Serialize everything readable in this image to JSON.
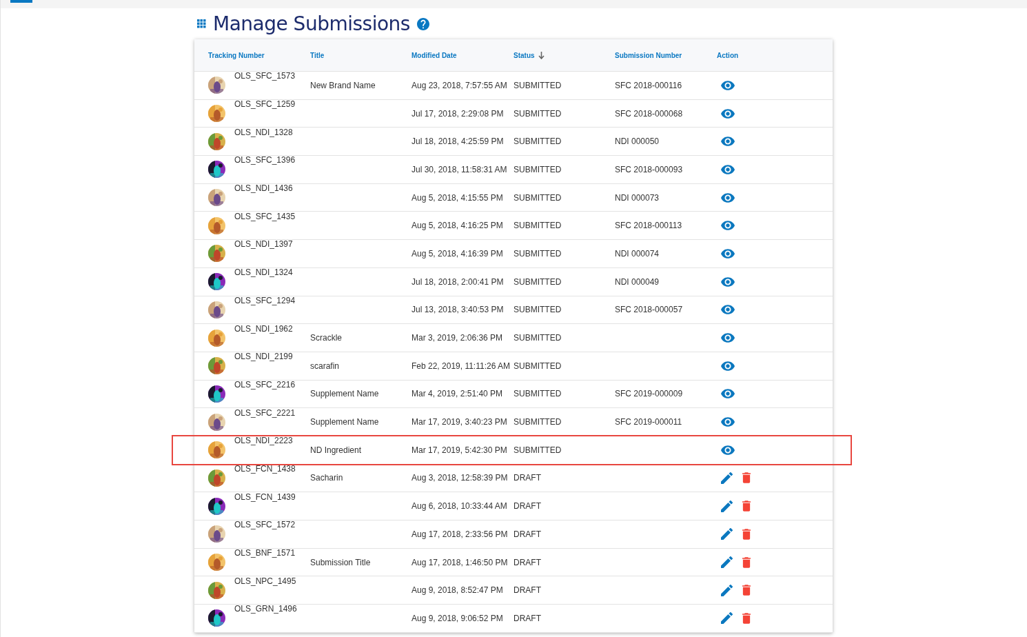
{
  "page": {
    "title": "Manage Submissions"
  },
  "table": {
    "columns": [
      {
        "label": "Tracking Number",
        "sorted": false
      },
      {
        "label": "Title",
        "sorted": false
      },
      {
        "label": "Modified Date",
        "sorted": false
      },
      {
        "label": "Status",
        "sorted": true
      },
      {
        "label": "Submission Number",
        "sorted": false
      },
      {
        "label": "Action",
        "sorted": false
      }
    ],
    "rows": [
      {
        "tracking": "OLS_SFC_1573",
        "title": "New Brand Name",
        "modified": "Aug 23, 2018, 7:57:55 AM",
        "status": "SUBMITTED",
        "submission": "SFC 2018-000116",
        "kind": "viewable",
        "highlighted": false
      },
      {
        "tracking": "OLS_SFC_1259",
        "modified": "Jul 17, 2018, 2:29:08 PM",
        "status": "SUBMITTED",
        "submission": "SFC 2018-000068",
        "kind": "viewable",
        "highlighted": false
      },
      {
        "tracking": "OLS_NDI_1328",
        "modified": "Jul 18, 2018, 4:25:59 PM",
        "status": "SUBMITTED",
        "submission": "NDI 000050",
        "kind": "viewable",
        "highlighted": false
      },
      {
        "tracking": "OLS_SFC_1396",
        "modified": "Jul 30, 2018, 11:58:31 AM",
        "status": "SUBMITTED",
        "submission": "SFC 2018-000093",
        "kind": "viewable",
        "highlighted": false
      },
      {
        "tracking": "OLS_NDI_1436",
        "modified": "Aug 5, 2018, 4:15:55 PM",
        "status": "SUBMITTED",
        "submission": "NDI 000073",
        "kind": "viewable",
        "highlighted": false
      },
      {
        "tracking": "OLS_SFC_1435",
        "modified": "Aug 5, 2018, 4:16:25 PM",
        "status": "SUBMITTED",
        "submission": "SFC 2018-000113",
        "kind": "viewable",
        "highlighted": false
      },
      {
        "tracking": "OLS_NDI_1397",
        "modified": "Aug 5, 2018, 4:16:39 PM",
        "status": "SUBMITTED",
        "submission": "NDI 000074",
        "kind": "viewable",
        "highlighted": false
      },
      {
        "tracking": "OLS_NDI_1324",
        "modified": "Jul 18, 2018, 2:00:41 PM",
        "status": "SUBMITTED",
        "submission": "NDI 000049",
        "kind": "viewable",
        "highlighted": false
      },
      {
        "tracking": "OLS_SFC_1294",
        "modified": "Jul 13, 2018, 3:40:53 PM",
        "status": "SUBMITTED",
        "submission": "SFC 2018-000057",
        "kind": "viewable",
        "highlighted": false
      },
      {
        "tracking": "OLS_NDI_1962",
        "title": "Scrackle",
        "modified": "Mar 3, 2019, 2:06:36 PM",
        "status": "SUBMITTED",
        "kind": "viewable",
        "highlighted": false
      },
      {
        "tracking": "OLS_NDI_2199",
        "title": "scarafin",
        "modified": "Feb 22, 2019, 11:11:26 AM",
        "status": "SUBMITTED",
        "kind": "viewable",
        "highlighted": false
      },
      {
        "tracking": "OLS_SFC_2216",
        "title": "Supplement Name",
        "modified": "Mar 4, 2019, 2:51:40 PM",
        "status": "SUBMITTED",
        "submission": "SFC 2019-000009",
        "kind": "viewable",
        "highlighted": false
      },
      {
        "tracking": "OLS_SFC_2221",
        "title": "Supplement Name",
        "modified": "Mar 17, 2019, 3:40:23 PM",
        "status": "SUBMITTED",
        "submission": "SFC 2019-000011",
        "kind": "viewable",
        "highlighted": false
      },
      {
        "tracking": "OLS_NDI_2223",
        "title": "ND Ingredient",
        "modified": "Mar 17, 2019, 5:42:30 PM",
        "status": "SUBMITTED",
        "kind": "viewable",
        "highlighted": true
      },
      {
        "tracking": "OLS_FCN_1438",
        "title": "Sacharin",
        "modified": "Aug 3, 2018, 12:58:39 PM",
        "status": "DRAFT",
        "kind": "editable",
        "highlighted": false
      },
      {
        "tracking": "OLS_FCN_1439",
        "modified": "Aug 6, 2018, 10:33:44 AM",
        "status": "DRAFT",
        "kind": "editable",
        "highlighted": false
      },
      {
        "tracking": "OLS_SFC_1572",
        "modified": "Aug 17, 2018, 2:33:56 PM",
        "status": "DRAFT",
        "kind": "editable",
        "highlighted": false
      },
      {
        "tracking": "OLS_BNF_1571",
        "title": "Submission Title",
        "modified": "Aug 17, 2018, 1:46:50 PM",
        "status": "DRAFT",
        "kind": "editable",
        "highlighted": false
      },
      {
        "tracking": "OLS_NPC_1495",
        "modified": "Aug 9, 2018, 8:52:47 PM",
        "status": "DRAFT",
        "kind": "editable",
        "highlighted": false
      },
      {
        "tracking": "OLS_GRN_1496",
        "modified": "Aug 9, 2018, 9:06:52 PM",
        "status": "DRAFT",
        "kind": "editable",
        "highlighted": false
      }
    ]
  }
}
